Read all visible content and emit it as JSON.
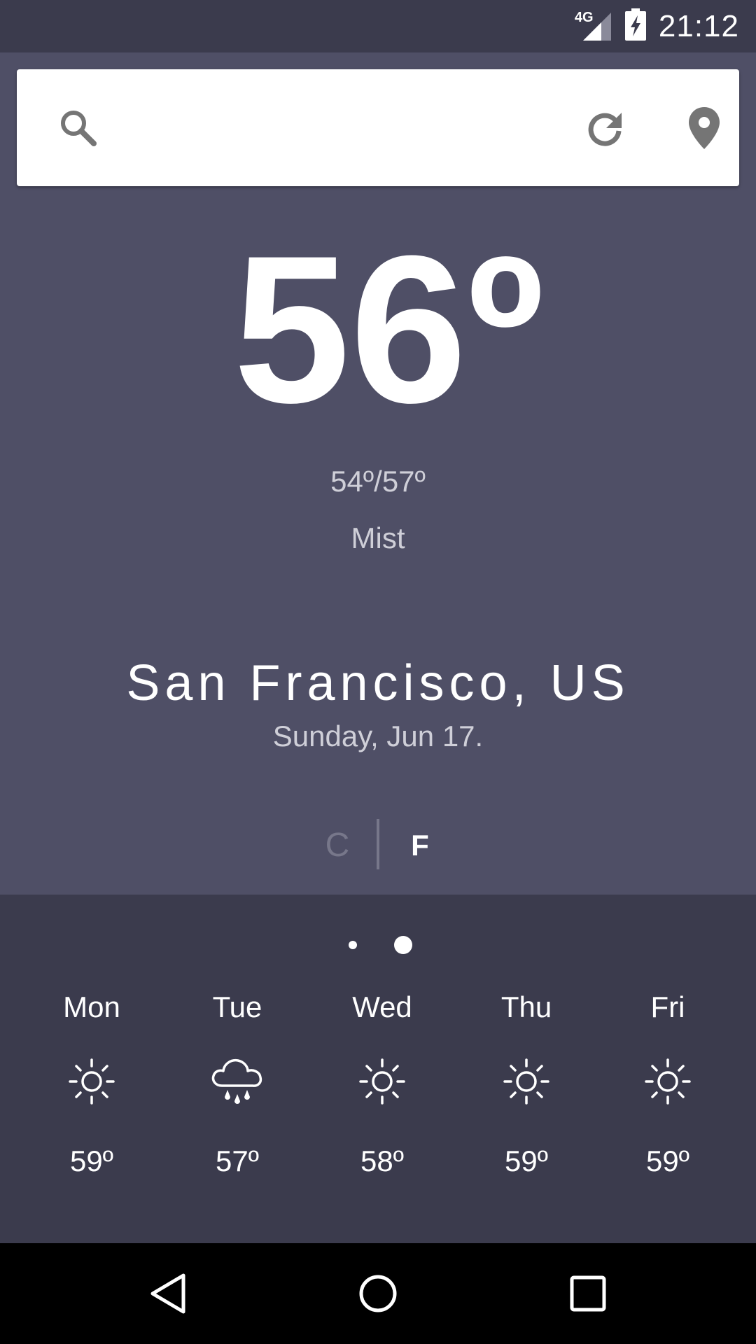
{
  "status_bar": {
    "network": "4G",
    "time": "21:12",
    "icons": [
      "signal-icon",
      "battery-charging-icon"
    ]
  },
  "search": {
    "placeholder": "",
    "value": "",
    "icons": [
      "search-icon",
      "refresh-icon",
      "location-pin-icon"
    ]
  },
  "current": {
    "temperature": "56º",
    "min_max": "54º/57º",
    "condition": "Mist",
    "city": "San Francisco, US",
    "date": "Sunday, Jun 17."
  },
  "units": {
    "celsius": "C",
    "fahrenheit": "F",
    "selected": "F"
  },
  "pager": {
    "count": 2,
    "active_index": 1
  },
  "forecast": [
    {
      "day": "Mon",
      "icon": "sun-icon",
      "temp": "59º"
    },
    {
      "day": "Tue",
      "icon": "rain-cloud-icon",
      "temp": "57º"
    },
    {
      "day": "Wed",
      "icon": "sun-icon",
      "temp": "58º"
    },
    {
      "day": "Thu",
      "icon": "sun-icon",
      "temp": "59º"
    },
    {
      "day": "Fri",
      "icon": "sun-icon",
      "temp": "59º"
    }
  ],
  "nav_bar": {
    "icons": [
      "back-icon",
      "home-icon",
      "recents-icon"
    ]
  },
  "colors": {
    "background": "#4f4f66",
    "panel": "#3b3b4d",
    "muted_text": "#cfcfd8",
    "inactive_unit": "#77778a"
  }
}
